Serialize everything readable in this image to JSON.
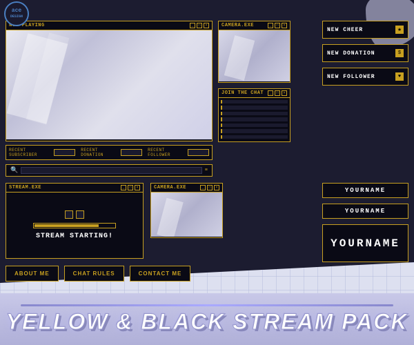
{
  "app": {
    "logo_text": "ace",
    "logo_subtext": "DESIGN"
  },
  "stream_pack": {
    "title": "YELLOW & BLACK STREAM PACK"
  },
  "panels": {
    "now_playing": {
      "title": "NOW PLAYING"
    },
    "camera_eye": {
      "title": "CAMERA.EXE"
    },
    "join_chat": {
      "title": "JOIN THE CHAT"
    },
    "stream_starting": {
      "title": "STREAM.EXE"
    },
    "camera2": {
      "title": "CAMERA.EXE"
    }
  },
  "alerts": {
    "new_cheer": "NEW CHEER",
    "new_donation": "NEW DONATION",
    "new_follower": "NEW FOLLOWER"
  },
  "recent": {
    "subscriber": "RECENT SUBSCRIBER",
    "donation": "RECENT DONATION",
    "follower": "RECENT FOLLOWER"
  },
  "stream_starting_text": "STREAM STARTING!",
  "name_panels": {
    "name1": "YOURNAME",
    "name2": "YOURNAME",
    "name3": "YOURNAME"
  },
  "buttons": {
    "about_me": "ABOUT ME",
    "chat_rules": "CHAT RULES",
    "contact_me": "CONTACT ME"
  }
}
